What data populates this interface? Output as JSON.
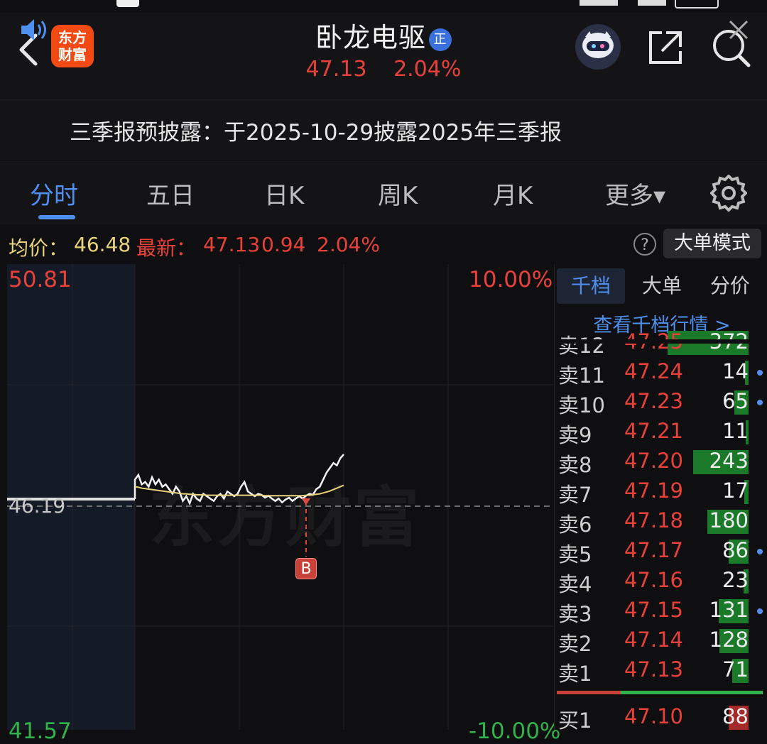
{
  "header": {
    "stock_name": "卧龙电驱",
    "badge": "正",
    "logo_line1": "东方",
    "logo_line2": "财富",
    "price": "47.13",
    "change_pct": "2.04%"
  },
  "notice": {
    "text": "三季报预披露：于2025-10-29披露2025年三季报"
  },
  "tabs": [
    {
      "label": "分时"
    },
    {
      "label": "五日"
    },
    {
      "label": "日K"
    },
    {
      "label": "周K"
    },
    {
      "label": "月K"
    },
    {
      "label": "更多▾"
    }
  ],
  "info": {
    "avg_label": "均价：",
    "avg_value": "46.48",
    "latest_label": "最新：",
    "latest_price": "47.13",
    "latest_change": "0.94",
    "latest_pct": "2.04%",
    "help": "?",
    "mode_button": "大单模式"
  },
  "chart_labels": {
    "top_price": "50.81",
    "top_pct": "10.00%",
    "mid_price": "46.19",
    "bottom_price": "41.57",
    "bottom_pct": "-10.00%",
    "marker": "B",
    "watermark": "东方财富"
  },
  "chart_data": {
    "type": "line",
    "ylim": [
      41.57,
      50.81
    ],
    "reference": 46.19,
    "series": [
      {
        "values": [
          46.19,
          46.19,
          46.19,
          46.19,
          46.19,
          46.19,
          46.19,
          46.19,
          46.19,
          46.19,
          46.19,
          46.19,
          46.19,
          46.19,
          46.19,
          46.19,
          46.19,
          46.19,
          46.19,
          46.19,
          46.19,
          46.19,
          46.19,
          46.19,
          46.19,
          46.19,
          46.19,
          46.19,
          46.19,
          46.19,
          46.19,
          46.19,
          46.19,
          46.19,
          46.19,
          46.19,
          46.19,
          46.19,
          46.19,
          46.19,
          46.19,
          46.19,
          46.19,
          46.19,
          46.19,
          46.19,
          46.19,
          46.19,
          46.19,
          46.19,
          46.19,
          46.19,
          46.19,
          46.19,
          46.19,
          46.19,
          46.19,
          46.19,
          46.19,
          46.19,
          46.19,
          46.19,
          46.19,
          46.19,
          46.19,
          46.19,
          46.19,
          46.19,
          46.19,
          46.19,
          46.19,
          46.19,
          46.19,
          46.19,
          46.19,
          46.19,
          46.19,
          46.19,
          46.19,
          46.19,
          46.19,
          46.19,
          46.19,
          46.19,
          46.19,
          46.19,
          46.19,
          46.19,
          46.19,
          46.19,
          46.19,
          46.19,
          46.19,
          46.19,
          46.19,
          46.19,
          46.19,
          46.19,
          46.19,
          46.19,
          46.19,
          46.19,
          46.19,
          46.19,
          46.19,
          46.19,
          46.19,
          46.19,
          46.19,
          46.19,
          46.19,
          46.19,
          46.19,
          46.19,
          46.19,
          46.19,
          46.19,
          46.19,
          46.19,
          46.19,
          46.19,
          46.19,
          46.19,
          46.19,
          46.19,
          46.19,
          46.19,
          46.19,
          46.19,
          46.19,
          46.19,
          46.19,
          46.19,
          46.19,
          46.19,
          46.19,
          46.19,
          46.19,
          46.19,
          46.19,
          46.19,
          46.19,
          46.19,
          46.19,
          46.19,
          46.19,
          46.19,
          46.19,
          46.19,
          46.19,
          46.19,
          46.19,
          46.19,
          46.19,
          46.19,
          46.19,
          46.19,
          46.19,
          46.19,
          46.19,
          46.19,
          46.19,
          46.19,
          46.19,
          46.19,
          46.19,
          46.19,
          46.19,
          46.19,
          46.19,
          46.19,
          46.19,
          46.19,
          46.19,
          46.19,
          46.19,
          46.19,
          46.19,
          46.19,
          46.19,
          46.19,
          46.19,
          46.19,
          46.19,
          46.19,
          46.19,
          46.19,
          46.19,
          46.19
        ]
      },
      {
        "values": [
          46.6,
          46.7,
          46.5,
          46.55,
          46.45,
          46.65,
          46.5,
          46.6,
          46.45,
          46.5,
          46.4,
          46.3,
          46.45,
          46.35,
          46.15,
          46.25,
          46.1,
          46.3,
          46.2,
          46.15,
          46.3,
          46.25,
          46.2,
          46.15,
          46.25,
          46.3,
          46.2,
          46.35,
          46.3,
          46.25,
          46.3,
          46.45,
          46.55,
          46.35,
          46.3,
          46.25,
          46.3,
          46.28,
          46.22,
          46.26,
          46.2,
          46.15,
          46.2,
          46.12,
          46.18,
          46.22,
          46.15,
          46.2,
          46.25,
          46.2,
          46.26,
          46.3,
          46.28,
          46.4,
          46.45,
          46.6,
          46.75,
          46.85,
          46.95,
          46.9,
          47.05,
          47.13
        ]
      },
      {
        "values": [
          46.45,
          46.44,
          46.42,
          46.41,
          46.4,
          46.39,
          46.38,
          46.37,
          46.36,
          46.35,
          46.34,
          46.33,
          46.32,
          46.31,
          46.3,
          46.3,
          46.29,
          46.29,
          46.28,
          46.28,
          46.28,
          46.27,
          46.27,
          46.27,
          46.27,
          46.27,
          46.27,
          46.27,
          46.27,
          46.27,
          46.27,
          46.27,
          46.27,
          46.27,
          46.27,
          46.27,
          46.27,
          46.27,
          46.26,
          46.26,
          46.26,
          46.26,
          46.26,
          46.26,
          46.26,
          46.26,
          46.26,
          46.26,
          46.26,
          46.26,
          46.27,
          46.27,
          46.28,
          46.29,
          46.3,
          46.32,
          46.34,
          46.36,
          46.39,
          46.42,
          46.45,
          46.48
        ]
      }
    ]
  },
  "book": {
    "tabs": [
      {
        "label": "千档"
      },
      {
        "label": "大单"
      },
      {
        "label": "分价"
      }
    ],
    "link": "查看千档行情 >",
    "sell": [
      {
        "label": "卖12",
        "price": "47.25",
        "vol": "372",
        "bar": 0.95,
        "dot": false
      },
      {
        "label": "卖11",
        "price": "47.24",
        "vol": "14",
        "bar": 0.04,
        "dot": true
      },
      {
        "label": "卖10",
        "price": "47.23",
        "vol": "65",
        "bar": 0.17,
        "dot": true
      },
      {
        "label": "卖9",
        "price": "47.21",
        "vol": "11",
        "bar": 0.03,
        "dot": false
      },
      {
        "label": "卖8",
        "price": "47.20",
        "vol": "243",
        "bar": 0.65,
        "dot": false
      },
      {
        "label": "卖7",
        "price": "47.19",
        "vol": "17",
        "bar": 0.05,
        "dot": false
      },
      {
        "label": "卖6",
        "price": "47.18",
        "vol": "180",
        "bar": 0.48,
        "dot": false
      },
      {
        "label": "卖5",
        "price": "47.17",
        "vol": "86",
        "bar": 0.23,
        "dot": true
      },
      {
        "label": "卖4",
        "price": "47.16",
        "vol": "23",
        "bar": 0.06,
        "dot": false
      },
      {
        "label": "卖3",
        "price": "47.15",
        "vol": "131",
        "bar": 0.35,
        "dot": true
      },
      {
        "label": "卖2",
        "price": "47.14",
        "vol": "128",
        "bar": 0.34,
        "dot": false
      },
      {
        "label": "卖1",
        "price": "47.13",
        "vol": "71",
        "bar": 0.19,
        "dot": false
      }
    ],
    "buy": [
      {
        "label": "买1",
        "price": "47.10",
        "vol": "88",
        "bar": 0.23,
        "dot": false
      }
    ]
  },
  "colors": {
    "up": "#e8413a",
    "down": "#2fb24a",
    "accent": "#4f8ff0",
    "avg_line": "#e8d27a"
  },
  "icons": {
    "back": "chevron-left-icon",
    "share": "share-icon",
    "search": "search-icon",
    "speaker": "speaker-icon",
    "close": "close-icon",
    "settings": "gear-icon",
    "robot": "robot-avatar-icon"
  }
}
